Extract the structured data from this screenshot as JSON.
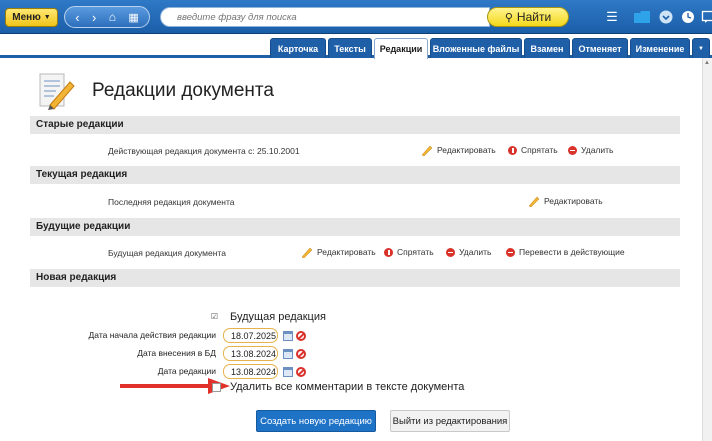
{
  "toolbar": {
    "menu_label": "Меню",
    "search_placeholder": "введите фразу для поиска",
    "find_label": "Найти"
  },
  "tabs": [
    {
      "label": "Карточка",
      "active": false
    },
    {
      "label": "Тексты",
      "active": false
    },
    {
      "label": "Редакции",
      "active": true
    },
    {
      "label": "Вложенные файлы",
      "active": false
    },
    {
      "label": "Взамен",
      "active": false
    },
    {
      "label": "Отменяет",
      "active": false
    },
    {
      "label": "Изменение",
      "active": false
    }
  ],
  "page": {
    "title": "Редакции документа"
  },
  "sections": {
    "old": {
      "title": "Старые редакции",
      "row_text": "Действующая редакция документа с: 25.10.2001",
      "edit": "Редактировать",
      "hide": "Спрятать",
      "delete": "Удалить"
    },
    "current": {
      "title": "Текущая редакция",
      "row_text": "Последняя редакция документа",
      "edit": "Редактировать"
    },
    "future": {
      "title": "Будущие редакции",
      "row_text": "Будущая редакция документа",
      "edit": "Редактировать",
      "hide": "Спрятать",
      "delete": "Удалить",
      "make_current": "Перевести в действующие"
    },
    "new": {
      "title": "Новая редакция"
    }
  },
  "form": {
    "future_checkbox_label": "Будущая редакция",
    "future_checked": true,
    "start_date_label": "Дата начала действия редакции",
    "start_date_value": "18.07.2025",
    "db_date_label": "Дата внесения в БД",
    "db_date_value": "13.08.2024",
    "edition_date_label": "Дата редакции",
    "edition_date_value": "13.08.2024",
    "delete_comments_label": "Удалить все комментарии в тексте документа",
    "delete_comments_checked": false,
    "create_button": "Создать новую редакцию",
    "exit_button": "Выйти из редактирования"
  },
  "colors": {
    "toolbar_blue": "#1f5fa8",
    "accent_yellow": "#f4d81a",
    "primary_button": "#1f73c7",
    "arrow_red": "#e0312b"
  }
}
